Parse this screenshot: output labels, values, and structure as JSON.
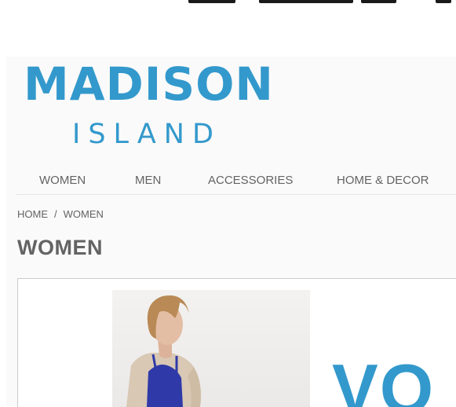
{
  "brand": {
    "name_line1": "MADISON",
    "name_line2": "ISLAND",
    "color": "#3399cc"
  },
  "nav": {
    "items": [
      {
        "label": "WOMEN"
      },
      {
        "label": "MEN"
      },
      {
        "label": "ACCESSORIES"
      },
      {
        "label": "HOME & DECOR"
      }
    ]
  },
  "breadcrumb": {
    "home": "HOME",
    "separator": "/",
    "current": "WOMEN"
  },
  "page": {
    "title": "WOMEN"
  },
  "hero": {
    "text": "VO",
    "image_subject": "woman in blue top and beige cardigan"
  },
  "colors": {
    "text": "#636363",
    "accent": "#3399cc",
    "page_bg": "#fbfafa"
  }
}
